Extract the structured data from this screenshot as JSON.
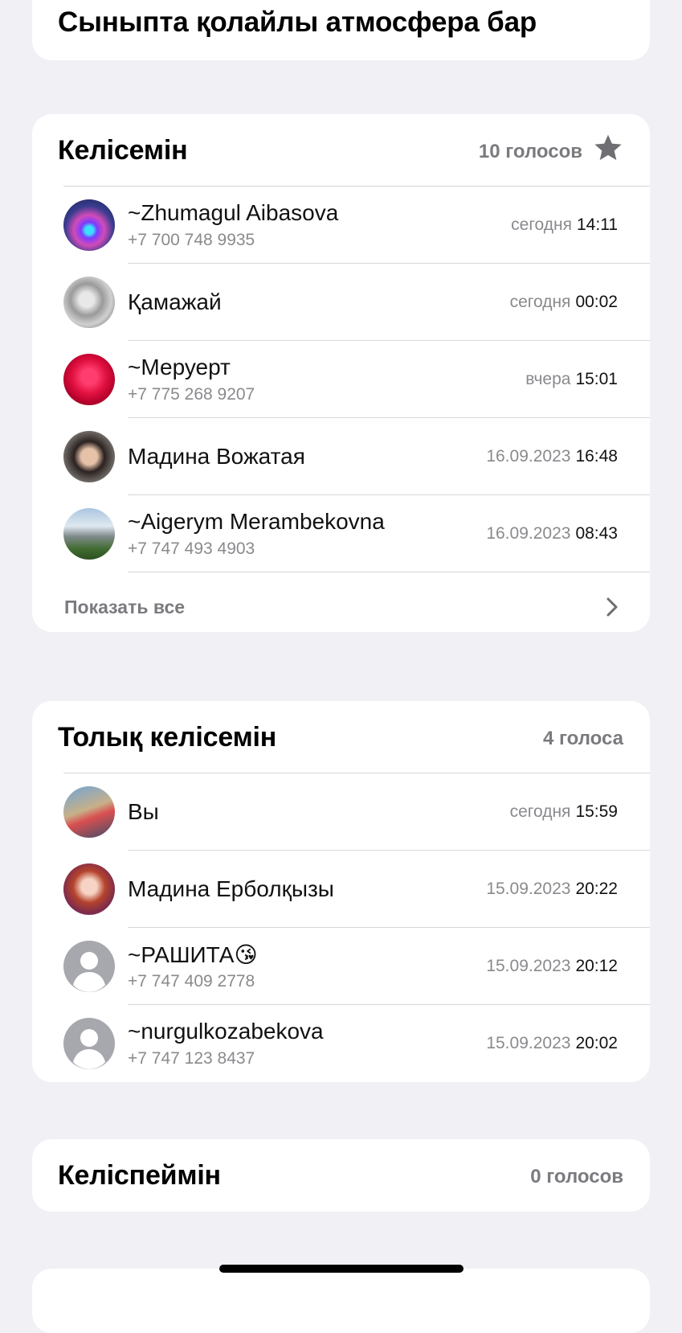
{
  "question": "Сыныпта қолайлы атмосфера бар",
  "options": [
    {
      "title": "Келісемін",
      "votes": "10 голосов",
      "starred": true,
      "voters": [
        {
          "name": "~Zhumagul Aibasova",
          "phone": "+7 700 748 9935",
          "day": "сегодня",
          "time": "14:11",
          "avatar": "photo-avatar"
        },
        {
          "name": "Қамажай",
          "phone": "",
          "day": "сегодня",
          "time": "00:02",
          "avatar": "photo-avatar"
        },
        {
          "name": "~Меруерт",
          "phone": "+7 775 268 9207",
          "day": "вчера",
          "time": "15:01",
          "avatar": "photo-avatar"
        },
        {
          "name": "Мадина Вожатая",
          "phone": "",
          "day": "16.09.2023",
          "time": "16:48",
          "avatar": "photo-avatar"
        },
        {
          "name": "~Aigerym Merambekovna",
          "phone": "+7 747 493 4903",
          "day": "16.09.2023",
          "time": "08:43",
          "avatar": "photo-avatar"
        }
      ],
      "show_all": "Показать все"
    },
    {
      "title": "Толық келісемін",
      "votes": "4 голоса",
      "starred": false,
      "voters": [
        {
          "name": "Вы",
          "phone": "",
          "day": "сегодня",
          "time": "15:59",
          "avatar": "photo-avatar"
        },
        {
          "name": "Мадина Ерболқызы",
          "phone": "",
          "day": "15.09.2023",
          "time": "20:22",
          "avatar": "photo-avatar"
        },
        {
          "name": "~РАШИТА😘",
          "phone": "+7 747 409 2778",
          "day": "15.09.2023",
          "time": "20:12",
          "avatar": "default-person-icon"
        },
        {
          "name": "~nurgulkozabekova",
          "phone": "+7 747 123 8437",
          "day": "15.09.2023",
          "time": "20:02",
          "avatar": "default-person-icon"
        }
      ]
    },
    {
      "title": "Келіспеймін",
      "votes": "0 голосов",
      "starred": false,
      "voters": []
    }
  ],
  "colors": {
    "background": "#f0f0f5",
    "card": "#ffffff",
    "secondary_text": "#8a8a8e",
    "separator": "#d7d7dc"
  }
}
